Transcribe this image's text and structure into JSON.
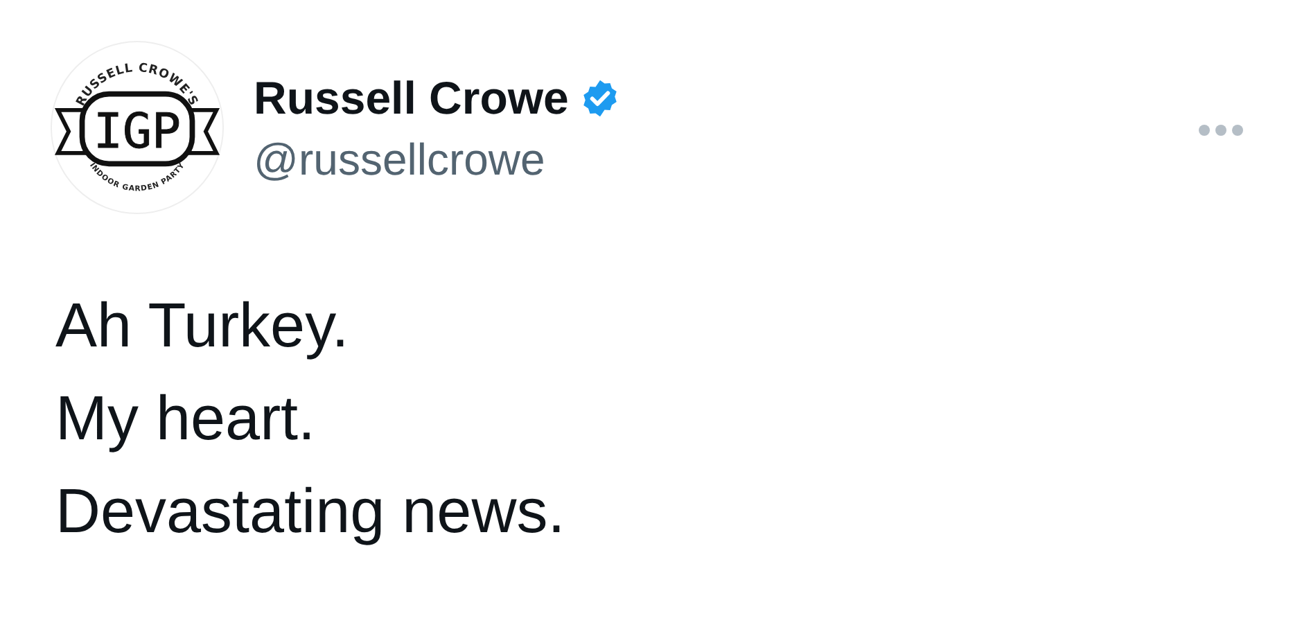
{
  "author": {
    "avatar": {
      "top_text": "RUSSELL CROWE'S",
      "monogram": "IGP",
      "bottom_text": "INDOOR GARDEN PARTY"
    },
    "name": "Russell Crowe",
    "verified": true,
    "handle": "@russellcrowe"
  },
  "tweet": {
    "lines": [
      "Ah Turkey.",
      "My heart.",
      "Devastating news."
    ]
  }
}
